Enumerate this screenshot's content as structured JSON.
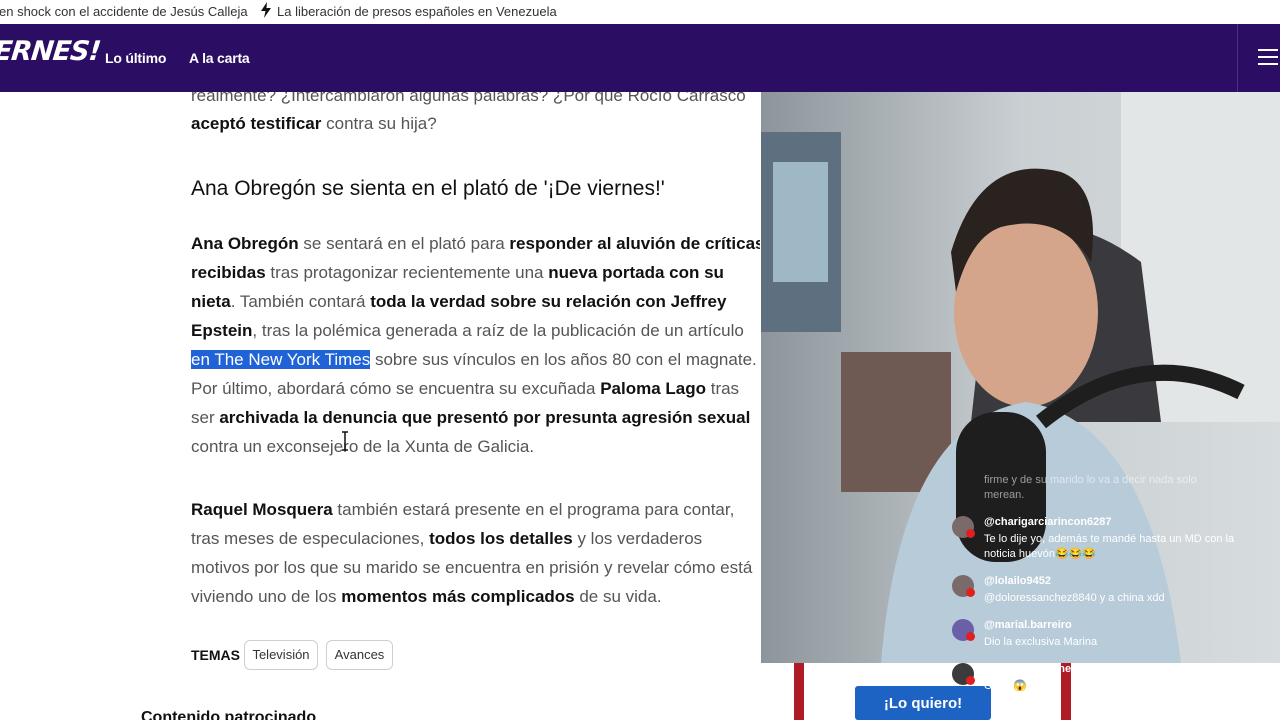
{
  "ticker": {
    "item1": "en shock con el accidente de Jesús Calleja",
    "item2": "La liberación de presos españoles en Venezuela"
  },
  "nav": {
    "brand": "ERNES!",
    "links": [
      "Lo último",
      "A la carta"
    ]
  },
  "article": {
    "top_line1": "realmente? ¿Intercambiaron algunas palabras? ¿Por qué Rocío Carrasco",
    "top_line2_bold": "aceptó testificar",
    "top_line2_rest": " contra su hija?",
    "heading": "Ana Obregón se sienta en el plató de '¡De viernes!'",
    "p1": {
      "l1_b1": "Ana Obregón",
      "l1_t1": " se sentará en el plató para ",
      "l1_b2": "responder al aluvión de críticas",
      "l2_b1": "recibidas",
      "l2_t1": " tras protagonizar recientemente una ",
      "l2_b2": "nueva portada con su",
      "l3_b1": "nieta",
      "l3_t1": ". También contará ",
      "l3_b2": "toda la verdad sobre su relación con Jeffrey",
      "l4_b1": "Epstein",
      "l4_t1": ", tras la polémica generada a raíz de la publicación de un artículo",
      "l5_hl": "en The New York Times",
      "l5_t1": " sobre sus vínculos en los años 80 con el magnate.",
      "l6_t1": "Por último, abordará cómo se encuentra su excuñada ",
      "l6_b1": "Paloma Lago",
      "l6_t2": " tras",
      "l7_t1": "ser ",
      "l7_b1": "archivada la denuncia que presentó por presunta agresión sexual",
      "l8_t1": "contra un exconsejero de la Xunta de Galicia."
    },
    "p2": {
      "l1_b1": "Raquel Mosquera",
      "l1_t1": " también estará presente en el programa para contar,",
      "l2_t1": "tras meses de especulaciones, ",
      "l2_b1": "todos los detalles",
      "l2_t2": " y los verdaderos",
      "l3_t1": "motivos por los que su marido se encuentra en prisión y revelar cómo está",
      "l4_t1": "viviendo uno de los ",
      "l4_b1": "momentos más complicados",
      "l4_t2": " de su vida."
    },
    "temas_label": "TEMAS",
    "tags": [
      "Televisión",
      "Avances"
    ],
    "sponsored": "Contenido patrocinado"
  },
  "overlay": {
    "faded_text": "firme y de su marido lo va a decir nada solo merean.",
    "chat": [
      {
        "user": "@charigarciarincon6287",
        "text": "Te lo dije yo, además te mandé hasta un MD con la noticia huevón😂😂😂"
      },
      {
        "user": "@lolailo9452",
        "text": "@doloressanchez8840 y a china xdd"
      },
      {
        "user": "@marial.barreiro",
        "text": "Dio la exclusiva Marina"
      },
      {
        "user": "@NymphMartínez",
        "text": "OMG 😱"
      }
    ],
    "cta_label": "¡Lo quiero!"
  },
  "colors": {
    "nav_bg": "#2b0d63",
    "highlight": "#1f63d6",
    "cta": "#1d63c3"
  },
  "icons": [
    "lightning-icon",
    "hamburger-menu-icon",
    "text-cursor-icon"
  ]
}
